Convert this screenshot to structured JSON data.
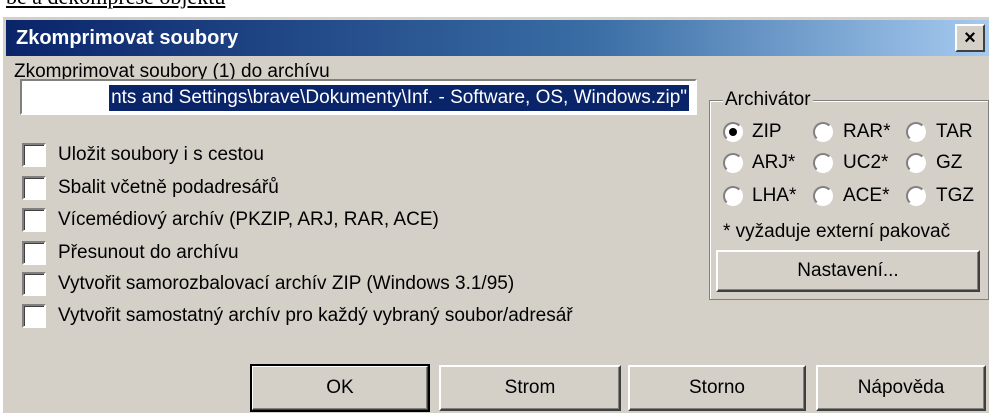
{
  "above_text": "be a dekomprese objektu",
  "dialog": {
    "title": "Zkomprimovat soubory",
    "close_label": "×",
    "compress_label": "Zkomprimovat soubory (1) do archívu",
    "path_value": "nts and Settings\\brave\\Dokumenty\\Inf. - Software, OS, Windows.zip\""
  },
  "options": [
    {
      "label": "Uložit soubory i s cestou",
      "checked": false
    },
    {
      "label": "Sbalit včetně podadresářů",
      "checked": false
    },
    {
      "label": "Vícemédiový archív (PKZIP, ARJ, RAR, ACE)",
      "checked": false
    },
    {
      "label": "Přesunout do archívu",
      "checked": false
    },
    {
      "label": "Vytvořit samorozbalovací archív ZIP (Windows 3.1/95)",
      "checked": false
    },
    {
      "label": "Vytvořit samostatný archív pro každý vybraný soubor/adresář",
      "checked": false
    }
  ],
  "archiver": {
    "title": "Archivátor",
    "selected": "ZIP",
    "formats": [
      "ZIP",
      "RAR*",
      "TAR",
      "ARJ*",
      "UC2*",
      "GZ",
      "LHA*",
      "ACE*",
      "TGZ"
    ],
    "note": "* vyžaduje externí pakovač",
    "settings_button": "Nastavení..."
  },
  "buttons": {
    "ok": "OK",
    "tree": "Strom",
    "cancel": "Storno",
    "help": "Nápověda"
  }
}
